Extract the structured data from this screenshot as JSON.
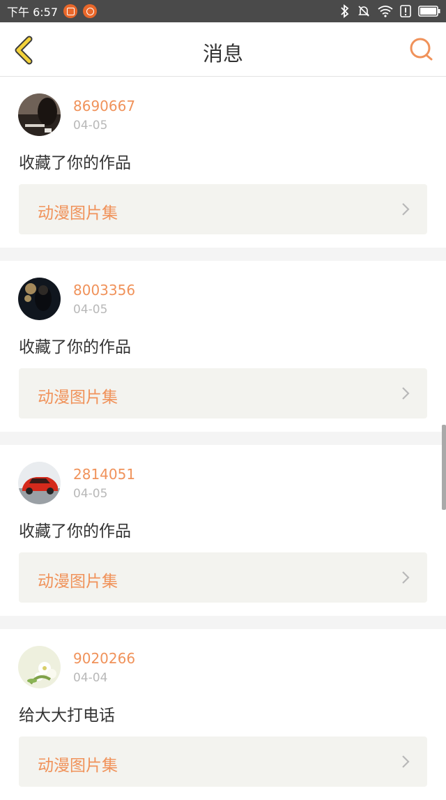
{
  "status_bar": {
    "time": "下午 6:57",
    "icons": [
      "app-notification-icon",
      "warning-notification-icon",
      "bluetooth-icon",
      "mute-bell-icon",
      "wifi-icon",
      "alert-icon",
      "battery-icon"
    ]
  },
  "header": {
    "title": "消息",
    "back_icon": "chevron-left-icon",
    "search_icon": "search-icon"
  },
  "messages": [
    {
      "username": "8690667",
      "date": "04-05",
      "action": "收藏了你的作品",
      "work_title": "动漫图片集"
    },
    {
      "username": "8003356",
      "date": "04-05",
      "action": "收藏了你的作品",
      "work_title": "动漫图片集"
    },
    {
      "username": "2814051",
      "date": "04-05",
      "action": "收藏了你的作品",
      "work_title": "动漫图片集"
    },
    {
      "username": "9020266",
      "date": "04-04",
      "action": "给大大打电话",
      "work_title": "动漫图片集"
    }
  ],
  "colors": {
    "accent": "#f0925a",
    "back_arrow": "#f3d23b",
    "status_bar": "#4a4a4a",
    "card_inner": "#f3f3ef"
  }
}
